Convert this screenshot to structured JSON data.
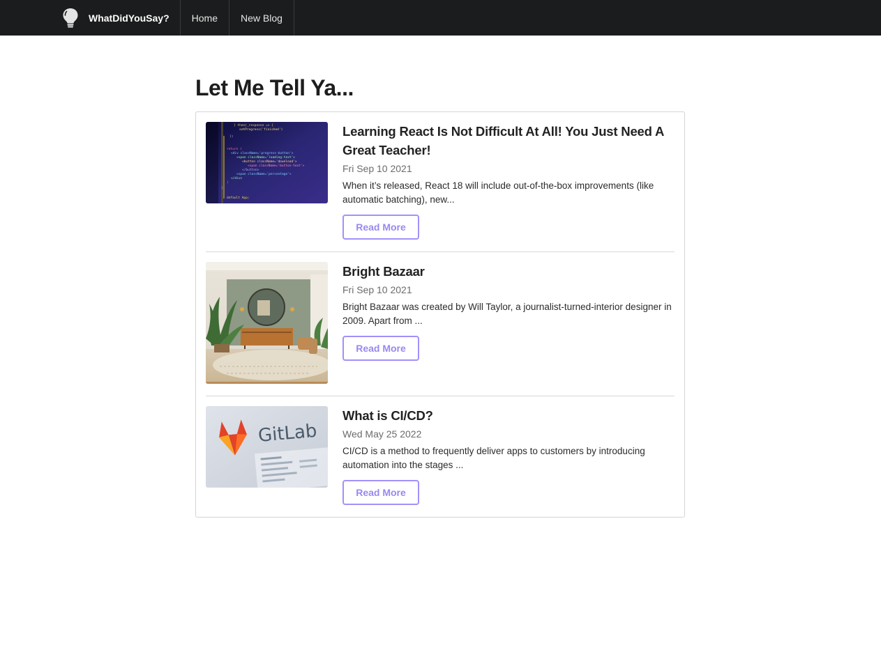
{
  "nav": {
    "brand": "WhatDidYouSay?",
    "brand_icon": "lightbulb-icon",
    "items": [
      {
        "label": "Home"
      },
      {
        "label": "New Blog"
      }
    ]
  },
  "main": {
    "title": "Let Me Tell Ya...",
    "posts": [
      {
        "title": "Learning React Is Not Difficult At All! You Just Need A Great Teacher!",
        "date": "Fri Sep 10 2021",
        "excerpt": "When it’s released, React 18 will include out-of-the-box improvements (like automatic batching), new...",
        "button": "Read More",
        "image": "code-editor-image"
      },
      {
        "title": "Bright Bazaar",
        "date": "Fri Sep 10 2021",
        "excerpt": "Bright Bazaar was created by Will Taylor, a journalist-turned-interior designer in 2009. Apart from ...",
        "button": "Read More",
        "image": "interior-room-image"
      },
      {
        "title": "What is CI/CD?",
        "date": "Wed May 25 2022",
        "excerpt": "CI/CD is a method to frequently deliver apps to customers by introducing automation into the stages ...",
        "button": "Read More",
        "image": "gitlab-logo-image",
        "image_text": "GitLab"
      }
    ]
  },
  "colors": {
    "navbar": "#1b1c1d",
    "accent": "#a291fb"
  }
}
